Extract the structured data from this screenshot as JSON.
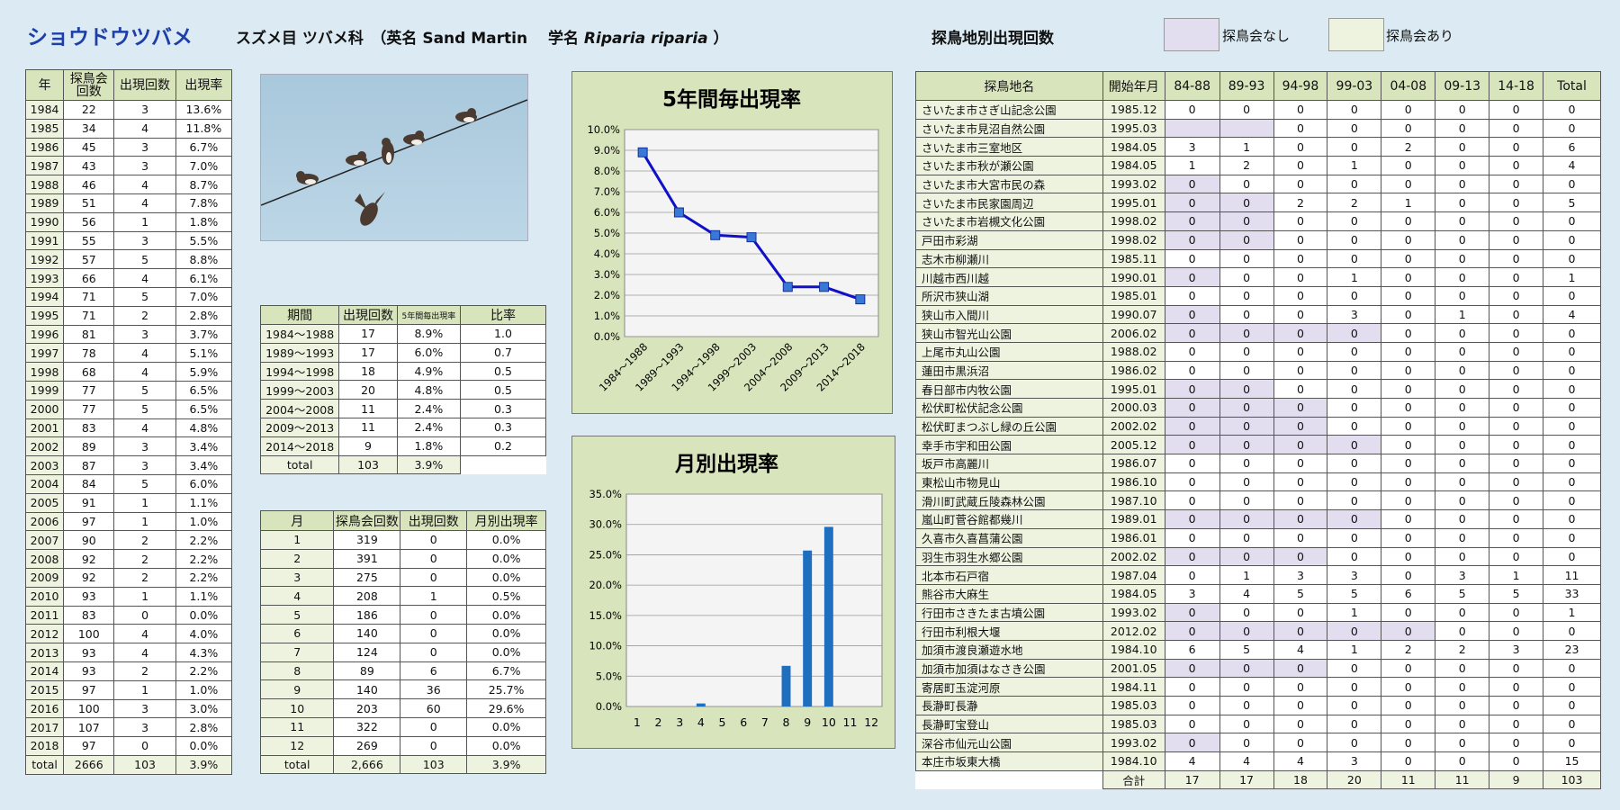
{
  "header": {
    "title": "ショウドウツバメ",
    "subtitle_a": "スズメ目 ツバメ科　（英名 Sand Martin　 学名 ",
    "subtitle_latin": "Riparia riparia",
    "subtitle_b": " ）",
    "sites_title": "探鳥地別出現回数",
    "legend_none": "探鳥会なし",
    "legend_yes": "探鳥会あり",
    "legend_none_color": "#e3ddf0",
    "legend_yes_color": "#eef3e0"
  },
  "year_table": {
    "headers": [
      "年",
      "探鳥会\n回数",
      "出現回数",
      "出現率"
    ],
    "rows": [
      [
        "1984",
        "22",
        "3",
        "13.6%"
      ],
      [
        "1985",
        "34",
        "4",
        "11.8%"
      ],
      [
        "1986",
        "45",
        "3",
        "6.7%"
      ],
      [
        "1987",
        "43",
        "3",
        "7.0%"
      ],
      [
        "1988",
        "46",
        "4",
        "8.7%"
      ],
      [
        "1989",
        "51",
        "4",
        "7.8%"
      ],
      [
        "1990",
        "56",
        "1",
        "1.8%"
      ],
      [
        "1991",
        "55",
        "3",
        "5.5%"
      ],
      [
        "1992",
        "57",
        "5",
        "8.8%"
      ],
      [
        "1993",
        "66",
        "4",
        "6.1%"
      ],
      [
        "1994",
        "71",
        "5",
        "7.0%"
      ],
      [
        "1995",
        "71",
        "2",
        "2.8%"
      ],
      [
        "1996",
        "81",
        "3",
        "3.7%"
      ],
      [
        "1997",
        "78",
        "4",
        "5.1%"
      ],
      [
        "1998",
        "68",
        "4",
        "5.9%"
      ],
      [
        "1999",
        "77",
        "5",
        "6.5%"
      ],
      [
        "2000",
        "77",
        "5",
        "6.5%"
      ],
      [
        "2001",
        "83",
        "4",
        "4.8%"
      ],
      [
        "2002",
        "89",
        "3",
        "3.4%"
      ],
      [
        "2003",
        "87",
        "3",
        "3.4%"
      ],
      [
        "2004",
        "84",
        "5",
        "6.0%"
      ],
      [
        "2005",
        "91",
        "1",
        "1.1%"
      ],
      [
        "2006",
        "97",
        "1",
        "1.0%"
      ],
      [
        "2007",
        "90",
        "2",
        "2.2%"
      ],
      [
        "2008",
        "92",
        "2",
        "2.2%"
      ],
      [
        "2009",
        "92",
        "2",
        "2.2%"
      ],
      [
        "2010",
        "93",
        "1",
        "1.1%"
      ],
      [
        "2011",
        "83",
        "0",
        "0.0%"
      ],
      [
        "2012",
        "100",
        "4",
        "4.0%"
      ],
      [
        "2013",
        "93",
        "4",
        "4.3%"
      ],
      [
        "2014",
        "93",
        "2",
        "2.2%"
      ],
      [
        "2015",
        "97",
        "1",
        "1.0%"
      ],
      [
        "2016",
        "100",
        "3",
        "3.0%"
      ],
      [
        "2017",
        "107",
        "3",
        "2.8%"
      ],
      [
        "2018",
        "97",
        "0",
        "0.0%"
      ]
    ],
    "total": [
      "total",
      "2666",
      "103",
      "3.9%"
    ]
  },
  "period_table": {
    "headers": [
      "期間",
      "出現回数",
      "5年間毎出現率",
      "比率"
    ],
    "rows": [
      [
        "1984～1988",
        "17",
        "8.9%",
        "1.0"
      ],
      [
        "1989～1993",
        "17",
        "6.0%",
        "0.7"
      ],
      [
        "1994～1998",
        "18",
        "4.9%",
        "0.5"
      ],
      [
        "1999～2003",
        "20",
        "4.8%",
        "0.5"
      ],
      [
        "2004～2008",
        "11",
        "2.4%",
        "0.3"
      ],
      [
        "2009～2013",
        "11",
        "2.4%",
        "0.3"
      ],
      [
        "2014～2018",
        "9",
        "1.8%",
        "0.2"
      ]
    ],
    "total": [
      "total",
      "103",
      "3.9%"
    ]
  },
  "month_table": {
    "headers": [
      "月",
      "探鳥会回数",
      "出現回数",
      "月別出現率"
    ],
    "rows": [
      [
        "1",
        "319",
        "0",
        "0.0%"
      ],
      [
        "2",
        "391",
        "0",
        "0.0%"
      ],
      [
        "3",
        "275",
        "0",
        "0.0%"
      ],
      [
        "4",
        "208",
        "1",
        "0.5%"
      ],
      [
        "5",
        "186",
        "0",
        "0.0%"
      ],
      [
        "6",
        "140",
        "0",
        "0.0%"
      ],
      [
        "7",
        "124",
        "0",
        "0.0%"
      ],
      [
        "8",
        "89",
        "6",
        "6.7%"
      ],
      [
        "9",
        "140",
        "36",
        "25.7%"
      ],
      [
        "10",
        "203",
        "60",
        "29.6%"
      ],
      [
        "11",
        "322",
        "0",
        "0.0%"
      ],
      [
        "12",
        "269",
        "0",
        "0.0%"
      ]
    ],
    "total": [
      "total",
      "2,666",
      "103",
      "3.9%"
    ]
  },
  "chart_data": [
    {
      "type": "line",
      "title": "5年間毎出現率",
      "categories": [
        "1984～1988",
        "1989～1993",
        "1994～1998",
        "1999～2003",
        "2004～2008",
        "2009～2013",
        "2014～2018"
      ],
      "values": [
        8.9,
        6.0,
        4.9,
        4.8,
        2.4,
        2.4,
        1.8
      ],
      "ylim": [
        0,
        10
      ],
      "yticks": [
        "0.0%",
        "1.0%",
        "2.0%",
        "3.0%",
        "4.0%",
        "5.0%",
        "6.0%",
        "7.0%",
        "8.0%",
        "9.0%",
        "10.0%"
      ],
      "line_color": "#1010c8",
      "marker_color": "#3a78d8",
      "grid": true
    },
    {
      "type": "bar",
      "title": "月別出現率",
      "categories": [
        "1",
        "2",
        "3",
        "4",
        "5",
        "6",
        "7",
        "8",
        "9",
        "10",
        "11",
        "12"
      ],
      "values": [
        0,
        0,
        0,
        0.5,
        0,
        0,
        0,
        6.7,
        25.7,
        29.6,
        0,
        0
      ],
      "ylim": [
        0,
        35
      ],
      "yticks": [
        "0.0%",
        "5.0%",
        "10.0%",
        "15.0%",
        "20.0%",
        "25.0%",
        "30.0%",
        "35.0%"
      ],
      "bar_color": "#1f6fc0",
      "grid": true
    }
  ],
  "site_table": {
    "headers": [
      "探鳥地名",
      "開始年月",
      "84-88",
      "89-93",
      "94-98",
      "99-03",
      "04-08",
      "09-13",
      "14-18",
      "Total"
    ],
    "rows": [
      {
        "name": "さいたま市さぎ山記念公園",
        "start": "1985.12",
        "v": [
          "0",
          "0",
          "0",
          "0",
          "0",
          "0",
          "0",
          "0"
        ],
        "p": []
      },
      {
        "name": "さいたま市見沼自然公園",
        "start": "1995.03",
        "v": [
          "",
          "",
          "0",
          "0",
          "0",
          "0",
          "0",
          "0"
        ],
        "p": [
          0,
          1
        ]
      },
      {
        "name": "さいたま市三室地区",
        "start": "1984.05",
        "v": [
          "3",
          "1",
          "0",
          "0",
          "2",
          "0",
          "0",
          "6"
        ],
        "p": []
      },
      {
        "name": "さいたま市秋が瀬公園",
        "start": "1984.05",
        "v": [
          "1",
          "2",
          "0",
          "1",
          "0",
          "0",
          "0",
          "4"
        ],
        "p": []
      },
      {
        "name": "さいたま市大宮市民の森",
        "start": "1993.02",
        "v": [
          "0",
          "0",
          "0",
          "0",
          "0",
          "0",
          "0",
          "0"
        ],
        "p": [
          0
        ]
      },
      {
        "name": "さいたま市民家園周辺",
        "start": "1995.01",
        "v": [
          "0",
          "0",
          "2",
          "2",
          "1",
          "0",
          "0",
          "5"
        ],
        "p": [
          0,
          1
        ]
      },
      {
        "name": "さいたま市岩槻文化公園",
        "start": "1998.02",
        "v": [
          "0",
          "0",
          "0",
          "0",
          "0",
          "0",
          "0",
          "0"
        ],
        "p": [
          0,
          1
        ]
      },
      {
        "name": "戸田市彩湖",
        "start": "1998.02",
        "v": [
          "0",
          "0",
          "0",
          "0",
          "0",
          "0",
          "0",
          "0"
        ],
        "p": [
          0,
          1
        ]
      },
      {
        "name": "志木市柳瀬川",
        "start": "1985.11",
        "v": [
          "0",
          "0",
          "0",
          "0",
          "0",
          "0",
          "0",
          "0"
        ],
        "p": []
      },
      {
        "name": "川越市西川越",
        "start": "1990.01",
        "v": [
          "0",
          "0",
          "0",
          "1",
          "0",
          "0",
          "0",
          "1"
        ],
        "p": [
          0
        ]
      },
      {
        "name": "所沢市狭山湖",
        "start": "1985.01",
        "v": [
          "0",
          "0",
          "0",
          "0",
          "0",
          "0",
          "0",
          "0"
        ],
        "p": []
      },
      {
        "name": "狭山市入間川",
        "start": "1990.07",
        "v": [
          "0",
          "0",
          "0",
          "3",
          "0",
          "1",
          "0",
          "4"
        ],
        "p": [
          0
        ]
      },
      {
        "name": "狭山市智光山公園",
        "start": "2006.02",
        "v": [
          "0",
          "0",
          "0",
          "0",
          "0",
          "0",
          "0",
          "0"
        ],
        "p": [
          0,
          1,
          2,
          3
        ]
      },
      {
        "name": "上尾市丸山公園",
        "start": "1988.02",
        "v": [
          "0",
          "0",
          "0",
          "0",
          "0",
          "0",
          "0",
          "0"
        ],
        "p": []
      },
      {
        "name": "蓮田市黒浜沼",
        "start": "1986.02",
        "v": [
          "0",
          "0",
          "0",
          "0",
          "0",
          "0",
          "0",
          "0"
        ],
        "p": []
      },
      {
        "name": "春日部市内牧公園",
        "start": "1995.01",
        "v": [
          "0",
          "0",
          "0",
          "0",
          "0",
          "0",
          "0",
          "0"
        ],
        "p": [
          0,
          1
        ]
      },
      {
        "name": "松伏町松伏記念公園",
        "start": "2000.03",
        "v": [
          "0",
          "0",
          "0",
          "0",
          "0",
          "0",
          "0",
          "0"
        ],
        "p": [
          0,
          1,
          2
        ]
      },
      {
        "name": "松伏町まつぶし緑の丘公園",
        "start": "2002.02",
        "v": [
          "0",
          "0",
          "0",
          "0",
          "0",
          "0",
          "0",
          "0"
        ],
        "p": [
          0,
          1,
          2
        ]
      },
      {
        "name": "幸手市宇和田公園",
        "start": "2005.12",
        "v": [
          "0",
          "0",
          "0",
          "0",
          "0",
          "0",
          "0",
          "0"
        ],
        "p": [
          0,
          1,
          2,
          3
        ]
      },
      {
        "name": "坂戸市高麗川",
        "start": "1986.07",
        "v": [
          "0",
          "0",
          "0",
          "0",
          "0",
          "0",
          "0",
          "0"
        ],
        "p": []
      },
      {
        "name": "東松山市物見山",
        "start": "1986.10",
        "v": [
          "0",
          "0",
          "0",
          "0",
          "0",
          "0",
          "0",
          "0"
        ],
        "p": []
      },
      {
        "name": "滑川町武蔵丘陵森林公園",
        "start": "1987.10",
        "v": [
          "0",
          "0",
          "0",
          "0",
          "0",
          "0",
          "0",
          "0"
        ],
        "p": []
      },
      {
        "name": "嵐山町菅谷館都幾川",
        "start": "1989.01",
        "v": [
          "0",
          "0",
          "0",
          "0",
          "0",
          "0",
          "0",
          "0"
        ],
        "p": [
          0,
          1,
          2,
          3
        ]
      },
      {
        "name": "久喜市久喜菖蒲公園",
        "start": "1986.01",
        "v": [
          "0",
          "0",
          "0",
          "0",
          "0",
          "0",
          "0",
          "0"
        ],
        "p": []
      },
      {
        "name": "羽生市羽生水郷公園",
        "start": "2002.02",
        "v": [
          "0",
          "0",
          "0",
          "0",
          "0",
          "0",
          "0",
          "0"
        ],
        "p": [
          0,
          1,
          2
        ]
      },
      {
        "name": "北本市石戸宿",
        "start": "1987.04",
        "v": [
          "0",
          "1",
          "3",
          "3",
          "0",
          "3",
          "1",
          "11"
        ],
        "p": []
      },
      {
        "name": "熊谷市大麻生",
        "start": "1984.05",
        "v": [
          "3",
          "4",
          "5",
          "5",
          "6",
          "5",
          "5",
          "33"
        ],
        "p": []
      },
      {
        "name": "行田市さきたま古墳公園",
        "start": "1993.02",
        "v": [
          "0",
          "0",
          "0",
          "1",
          "0",
          "0",
          "0",
          "1"
        ],
        "p": [
          0
        ]
      },
      {
        "name": "行田市利根大堰",
        "start": "2012.02",
        "v": [
          "0",
          "0",
          "0",
          "0",
          "0",
          "0",
          "0",
          "0"
        ],
        "p": [
          0,
          1,
          2,
          3,
          4
        ]
      },
      {
        "name": "加須市渡良瀬遊水地",
        "start": "1984.10",
        "v": [
          "6",
          "5",
          "4",
          "1",
          "2",
          "2",
          "3",
          "23"
        ],
        "p": []
      },
      {
        "name": "加須市加須はなさき公園",
        "start": "2001.05",
        "v": [
          "0",
          "0",
          "0",
          "0",
          "0",
          "0",
          "0",
          "0"
        ],
        "p": [
          0,
          1,
          2
        ]
      },
      {
        "name": "寄居町玉淀河原",
        "start": "1984.11",
        "v": [
          "0",
          "0",
          "0",
          "0",
          "0",
          "0",
          "0",
          "0"
        ],
        "p": []
      },
      {
        "name": "長瀞町長瀞",
        "start": "1985.03",
        "v": [
          "0",
          "0",
          "0",
          "0",
          "0",
          "0",
          "0",
          "0"
        ],
        "p": []
      },
      {
        "name": "長瀞町宝登山",
        "start": "1985.03",
        "v": [
          "0",
          "0",
          "0",
          "0",
          "0",
          "0",
          "0",
          "0"
        ],
        "p": []
      },
      {
        "name": "深谷市仙元山公園",
        "start": "1993.02",
        "v": [
          "0",
          "0",
          "0",
          "0",
          "0",
          "0",
          "0",
          "0"
        ],
        "p": [
          0
        ]
      },
      {
        "name": "本庄市坂東大橋",
        "start": "1984.10",
        "v": [
          "4",
          "4",
          "4",
          "3",
          "0",
          "0",
          "0",
          "15"
        ],
        "p": []
      }
    ],
    "sum_label": "合計",
    "sums": [
      "17",
      "17",
      "18",
      "20",
      "11",
      "11",
      "9",
      "103"
    ]
  }
}
